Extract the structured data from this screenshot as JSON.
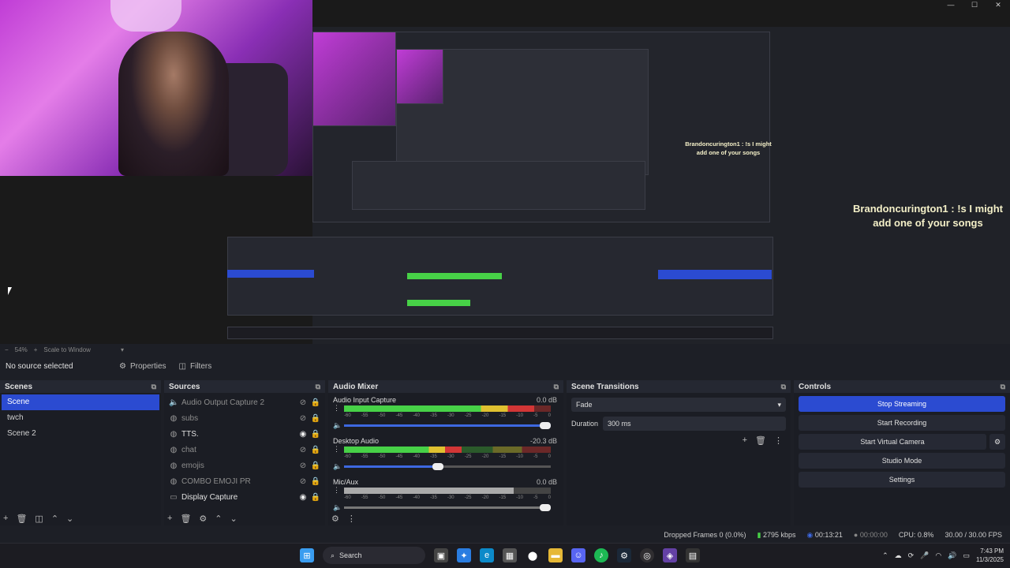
{
  "window_controls": [
    "—",
    "☐",
    "✕"
  ],
  "preview": {
    "chat_message_large": "Brandoncurington1 : !s I might add one of your songs",
    "chat_message_small": "Brandoncurington1 : !s I might add one of your songs"
  },
  "zoom_bar": {
    "zoom": "54%",
    "scale_mode": "Scale to Window"
  },
  "toolbar": {
    "selection_label": "No source selected",
    "properties_label": "Properties",
    "filters_label": "Filters"
  },
  "scenes": {
    "title": "Scenes",
    "items": [
      {
        "label": "Scene",
        "selected": true
      },
      {
        "label": "twch",
        "selected": false
      },
      {
        "label": "Scene 2",
        "selected": false
      }
    ]
  },
  "sources": {
    "title": "Sources",
    "items": [
      {
        "label": "Audio Output Capture 2",
        "icon": "speaker-icon",
        "visible": false
      },
      {
        "label": "subs",
        "icon": "globe-icon",
        "visible": false
      },
      {
        "label": "TTS.",
        "icon": "globe-icon",
        "visible": true
      },
      {
        "label": "chat",
        "icon": "globe-icon",
        "visible": false
      },
      {
        "label": "emojis",
        "icon": "globe-icon",
        "visible": false
      },
      {
        "label": "COMBO EMOJI PR",
        "icon": "globe-icon",
        "visible": false
      },
      {
        "label": "Display Capture",
        "icon": "monitor-icon",
        "visible": true
      }
    ]
  },
  "audio_mixer": {
    "title": "Audio Mixer",
    "channels": [
      {
        "name": "Audio Input Capture",
        "db": "0.0 dB",
        "level": 0.92,
        "volume": 1.0,
        "muted": false
      },
      {
        "name": "Desktop Audio",
        "db": "-20.3 dB",
        "level": 0.57,
        "volume": 0.48,
        "muted": false
      },
      {
        "name": "Mic/Aux",
        "db": "0.0 dB",
        "level": 0.82,
        "volume": 1.0,
        "muted": true
      }
    ],
    "ticks": [
      "-60",
      "-55",
      "-50",
      "-45",
      "-40",
      "-35",
      "-30",
      "-25",
      "-20",
      "-15",
      "-10",
      "-5",
      "0"
    ]
  },
  "scene_transitions": {
    "title": "Scene Transitions",
    "transition": "Fade",
    "duration_label": "Duration",
    "duration_value": "300 ms"
  },
  "controls": {
    "title": "Controls",
    "stop_streaming": "Stop Streaming",
    "start_recording": "Start Recording",
    "start_virtual_camera": "Start Virtual Camera",
    "studio_mode": "Studio Mode",
    "settings": "Settings"
  },
  "status_bar": {
    "dropped_frames": "Dropped Frames 0 (0.0%)",
    "bitrate": "2795 kbps",
    "stream_time": "00:13:21",
    "record_time": "00:00:00",
    "cpu": "CPU: 0.8%",
    "fps": "30.00 / 30.00 FPS"
  },
  "taskbar": {
    "search_placeholder": "Search",
    "time": "7:43 PM",
    "date": "11/3/2025"
  },
  "colors": {
    "accent": "#2b4bd1",
    "background": "#1d1f26",
    "panel": "#1b1d24"
  }
}
